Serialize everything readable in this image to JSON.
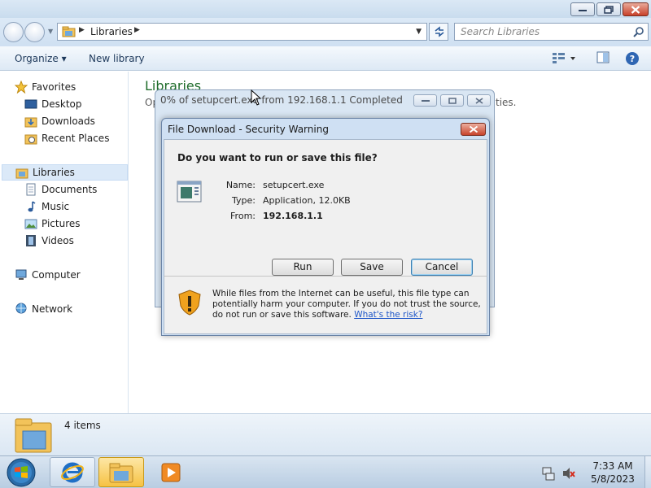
{
  "window": {
    "address": {
      "crumb": "Libraries"
    },
    "search": {
      "placeholder": "Search Libraries"
    },
    "toolbar": {
      "organize": "Organize",
      "new_library": "New library"
    },
    "sidebar": {
      "favorites": "Favorites",
      "favorites_items": [
        "Desktop",
        "Downloads",
        "Recent Places"
      ],
      "libraries": "Libraries",
      "libraries_items": [
        "Documents",
        "Music",
        "Pictures",
        "Videos"
      ],
      "computer": "Computer",
      "network": "Network"
    },
    "content": {
      "title": "Libraries",
      "subtitle_left": "Op",
      "subtitle_right": "ties."
    },
    "status": {
      "count": "4 items"
    }
  },
  "progress_window": {
    "title": "0% of setupcert.exe from 192.168.1.1 Completed"
  },
  "dialog": {
    "title": "File Download - Security Warning",
    "question": "Do you want to run or save this file?",
    "name_label": "Name:",
    "name_value": "setupcert.exe",
    "type_label": "Type:",
    "type_value": "Application, 12.0KB",
    "from_label": "From:",
    "from_value": "192.168.1.1",
    "run": "Run",
    "save": "Save",
    "cancel": "Cancel",
    "warning": "While files from the Internet can be useful, this file type can potentially harm your computer. If you do not trust the source, do not run or save this software.",
    "risk_link": "What's the risk?"
  },
  "taskbar": {
    "time": "7:33 AM",
    "date": "5/8/2023"
  }
}
